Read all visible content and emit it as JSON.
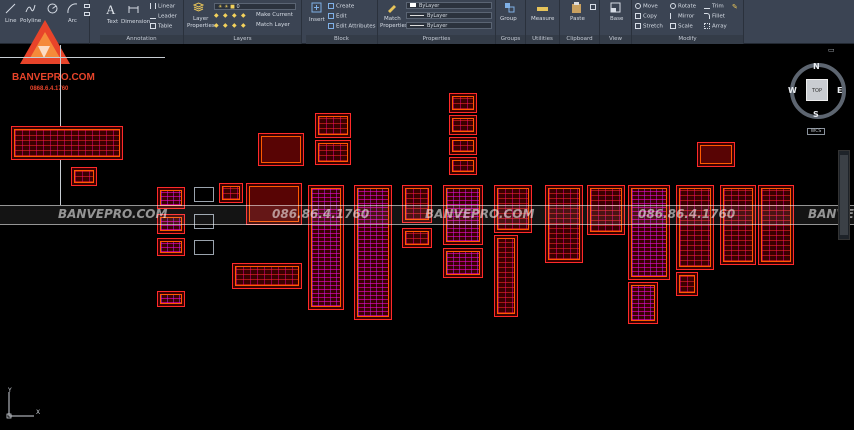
{
  "ribbon": {
    "draw": {
      "line": "Line",
      "polyline": "Polyline",
      "circle": "Circle",
      "arc": "Arc"
    },
    "annotation": {
      "text": "Text",
      "dimension": "Dimension",
      "linear": "Linear",
      "leader": "Leader",
      "table": "Table",
      "title": "Annotation"
    },
    "layers": {
      "layer_properties_top": "Layer",
      "layer_properties_bottom": "Properties",
      "layer_value": "0",
      "make_current": "Make Current",
      "match_layer": "Match Layer",
      "title": "Layers"
    },
    "block": {
      "insert": "Insert",
      "create": "Create",
      "edit": "Edit",
      "edit_attributes": "Edit Attributes",
      "title": "Block"
    },
    "properties": {
      "match_top": "Match",
      "match_bottom": "Properties",
      "color": "ByLayer",
      "linetype": "ByLayer",
      "lineweight": "ByLayer",
      "title": "Properties"
    },
    "groups": {
      "group": "Group",
      "title": "Groups"
    },
    "utilities": {
      "measure": "Measure",
      "title": "Utilities"
    },
    "clipboard": {
      "paste": "Paste",
      "title": "Clipboard"
    },
    "view": {
      "base": "Base",
      "title": "View"
    },
    "modify": {
      "move": "Move",
      "copy": "Copy",
      "stretch": "Stretch",
      "rotate": "Rotate",
      "mirror": "Mirror",
      "scale": "Scale",
      "trim": "Trim",
      "fillet": "Fillet",
      "array": "Array",
      "title": "Modify"
    }
  },
  "logo": {
    "name": "BANVEPRO.COM",
    "phone": "0868.6.4.1760"
  },
  "watermark": {
    "brand": "BANVEPRO.COM",
    "phone": "086.86.4.1760"
  },
  "viewcube": {
    "north": "N",
    "south": "S",
    "east": "E",
    "west": "W",
    "top_face": "TOP",
    "wcs": "WCS"
  },
  "ucs": {
    "x": "X",
    "y": "Y"
  },
  "colors": {
    "ribbon": "#3b4453",
    "canvas": "#000000",
    "sheet_border": "#ff2a2a",
    "accent_magenta": "#ff00c8",
    "logo": "#e8442a"
  }
}
